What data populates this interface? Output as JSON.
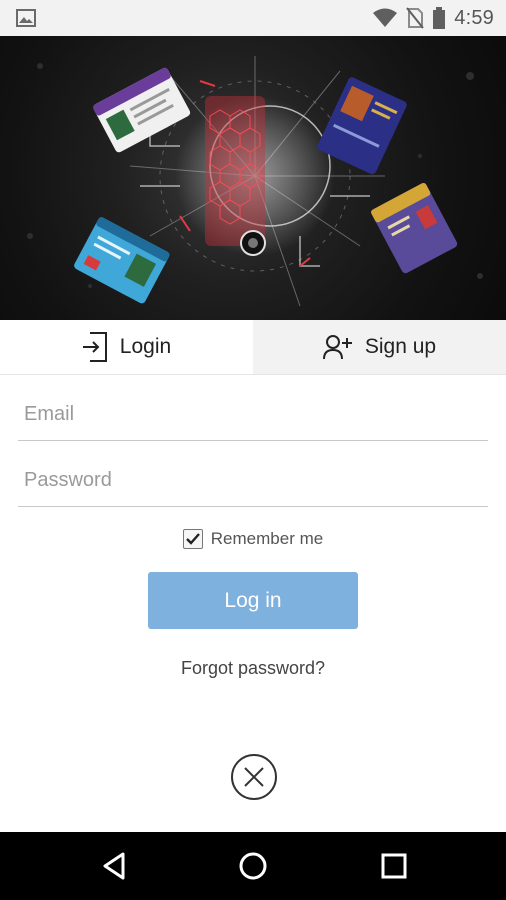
{
  "status_bar": {
    "time": "4:59",
    "icons": [
      "image-icon",
      "wifi-icon",
      "no-sim-icon",
      "battery-icon"
    ]
  },
  "tabs": [
    {
      "label": "Login",
      "icon": "login-icon",
      "active": true
    },
    {
      "label": "Sign up",
      "icon": "add-user-icon",
      "active": false
    }
  ],
  "form": {
    "email_placeholder": "Email",
    "password_placeholder": "Password",
    "remember_label": "Remember me",
    "remember_checked": true,
    "login_label": "Log in",
    "forgot_label": "Forgot password?"
  },
  "colors": {
    "login_button": "#7fb1de",
    "inactive_tab": "#f2f2f2"
  },
  "nav_bar": {
    "buttons": [
      "back-icon",
      "home-icon",
      "recents-icon"
    ]
  }
}
